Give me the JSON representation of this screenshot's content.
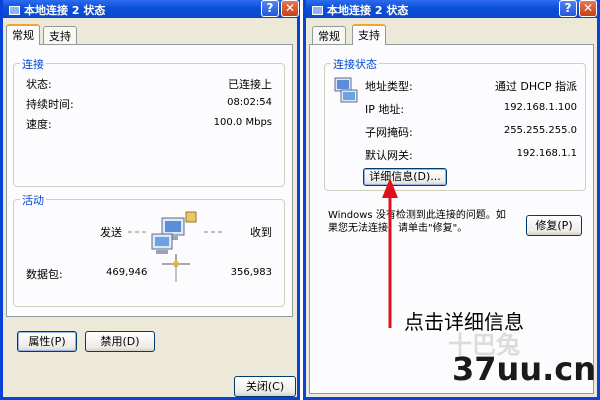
{
  "colors": {
    "titlebar": "#0a4fd8",
    "group_title": "#0046d5",
    "annotation_arrow": "#e0101a"
  },
  "left": {
    "title": "本地连接 2 状态",
    "tabs": [
      "常规",
      "支持"
    ],
    "connection": {
      "legend": "连接",
      "rows": [
        {
          "label": "状态:",
          "value": "已连接上"
        },
        {
          "label": "持续时间:",
          "value": "08:02:54"
        },
        {
          "label": "速度:",
          "value": "100.0 Mbps"
        }
      ]
    },
    "activity": {
      "legend": "活动",
      "sent_label": "发送",
      "recv_label": "收到",
      "packets_label": "数据包:",
      "sent_value": "469,946",
      "recv_value": "356,983"
    },
    "properties_button": "属性(P)",
    "disable_button": "禁用(D)",
    "close_button": "关闭(C)"
  },
  "right": {
    "title": "本地连接 2 状态",
    "tabs": [
      "常规",
      "支持"
    ],
    "status": {
      "legend": "连接状态",
      "rows": [
        {
          "label": "地址类型:",
          "value": "通过 DHCP 指派"
        },
        {
          "label": "IP 地址:",
          "value": "192.168.1.100"
        },
        {
          "label": "子网掩码:",
          "value": "255.255.255.0"
        },
        {
          "label": "默认网关:",
          "value": "192.168.1.1"
        }
      ],
      "details_button": "详细信息(D)..."
    },
    "note": "Windows 没有检测到此连接的问题。如果您无法连接，请单击\"修复\"。",
    "repair_button": "修复(P)",
    "annotation": "点击详细信息"
  },
  "watermark": {
    "site": "37uu.cn",
    "faint": "十巴兔"
  },
  "icons": {
    "help": "help-icon",
    "close": "close-icon",
    "network": "network-computers-icon"
  }
}
